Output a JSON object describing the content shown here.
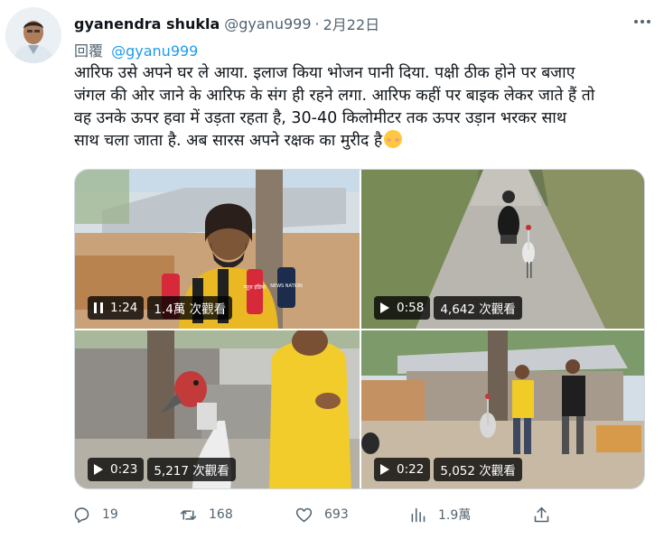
{
  "tweet": {
    "author_name": "gyanendra shukla",
    "author_handle": "@gyanu999",
    "separator": "·",
    "date": "2月22日",
    "reply_label": "回覆",
    "reply_to": "@gyanu999",
    "text": "आरिफ उसे अपने घर ले आया. इलाज किया भोजन पानी दिया. पक्षी ठीक होने पर बजाए\nजंगल की ओर जाने के आरिफ के संग ही रहने लगा. आरिफ कहीं पर बाइक लेकर जाते हैं तो\nवह उनके ऊपर हवा में उड़ता रहता है, 30-40 किलोमीटर तक ऊपर उड़ान भरकर साथ\nसाथ चला जाता है.  अब सारस अपने रक्षक का मुरीद है"
  },
  "media": [
    {
      "duration": "1:24",
      "views": "1.4萬 次觀看",
      "state": "playing",
      "mic_texts": [
        "न्यूज़ इंडिया",
        "NEWS NATION"
      ]
    },
    {
      "duration": "0:58",
      "views": "4,642 次觀看",
      "state": "paused"
    },
    {
      "duration": "0:23",
      "views": "5,217 次觀看",
      "state": "paused"
    },
    {
      "duration": "0:22",
      "views": "5,052 次觀看",
      "state": "paused"
    }
  ],
  "actions": {
    "replies": "19",
    "retweets": "168",
    "likes": "693",
    "views": "1.9萬"
  },
  "colors": {
    "text": "#0f1419",
    "secondary": "#536471",
    "link": "#1d9bf0",
    "border": "#cfd9de"
  },
  "icons": [
    "more-icon",
    "play-icon",
    "pause-icon",
    "reply-icon",
    "retweet-icon",
    "like-icon",
    "views-icon",
    "share-icon",
    "smiling-face-emoji"
  ]
}
